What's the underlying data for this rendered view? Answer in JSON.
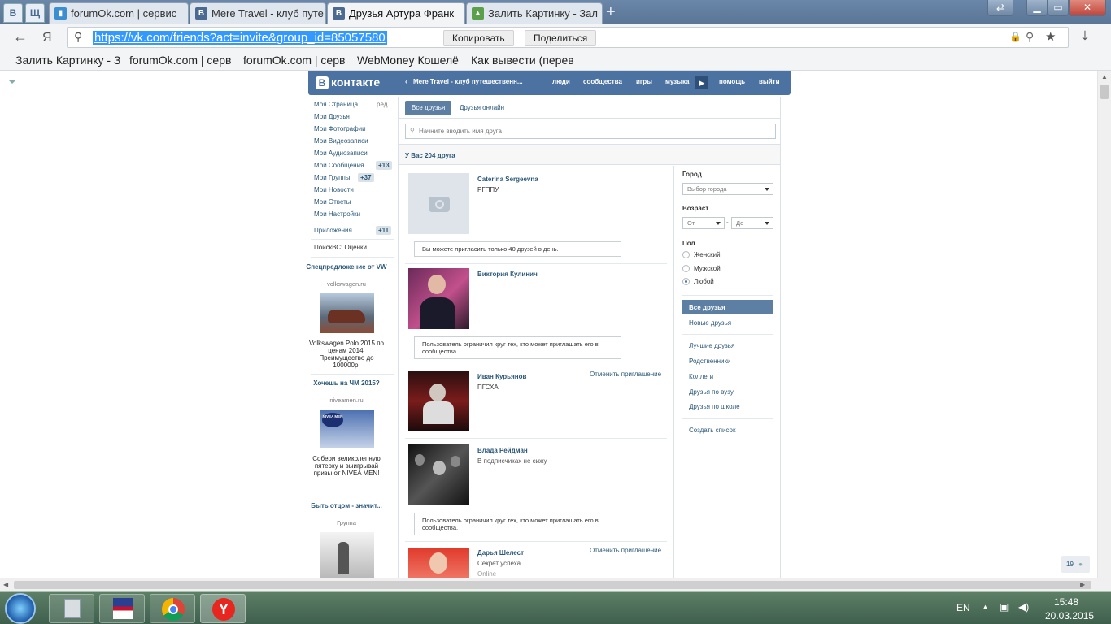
{
  "browser": {
    "pinned_tabs": [
      "В",
      "Щ"
    ],
    "tabs": [
      {
        "title": "forumOk.com | сервис",
        "icon": "chart-icon"
      },
      {
        "title": "Mere Travel - клуб путе",
        "icon": "vk-icon"
      },
      {
        "title": "Друзья Артура Франк",
        "icon": "vk-icon",
        "active": true
      },
      {
        "title": "Залить Картинку - Зал",
        "icon": "image-icon"
      }
    ],
    "new_tab": "+",
    "yandex_letter": "Я",
    "url": "https://vk.com/friends?act=invite&group_id=85057580",
    "copy_label": "Копировать",
    "share_label": "Поделиться",
    "bookmarks": [
      "Залить Картинку - З",
      "forumOk.com | серв",
      "forumOk.com | серв",
      "WebMoney Кошелё",
      "Как вывести (перев"
    ]
  },
  "vk": {
    "logo_b": "В",
    "logo_text": "контакте",
    "nav": {
      "group": "Mere Travel - клуб путешественн...",
      "people": "люди",
      "communities": "сообщества",
      "games": "игры",
      "music": "музыка",
      "help": "помощь",
      "logout": "выйти"
    },
    "left_menu": [
      {
        "label": "Моя Страница",
        "extra": "ред."
      },
      {
        "label": "Мои Друзья"
      },
      {
        "label": "Мои Фотографии"
      },
      {
        "label": "Мои Видеозаписи"
      },
      {
        "label": "Мои Аудиозаписи"
      },
      {
        "label": "Мои Сообщения",
        "count": "+13"
      },
      {
        "label": "Мои Группы",
        "count": "+37"
      },
      {
        "label": "Мои Новости"
      },
      {
        "label": "Мои Ответы"
      },
      {
        "label": "Мои Настройки"
      }
    ],
    "apps": {
      "label": "Приложения",
      "count": "+11"
    },
    "search_app": "ПоискВС: Оценки...",
    "ads": [
      {
        "title": "Спецпредложение от VW",
        "site": "volkswagen.ru",
        "text": "Volkswagen Polo 2015 по ценам 2014. Преимущество до 100000р."
      },
      {
        "title": "Хочешь на ЧМ 2015?",
        "site": "niveamen.ru",
        "text": "Собери великолепную пятерку и выигрывай призы от NIVEA MEN!"
      },
      {
        "title": "Быть отцом - значит...",
        "site": "Группа"
      }
    ],
    "nivea_logo": "NIVEA MEN",
    "tabs": {
      "all": "Все друзья",
      "online": "Друзья онлайн"
    },
    "search_placeholder": "Начните вводить имя друга",
    "count_text": "У Вас 204 друга",
    "friends": [
      {
        "name": "Caterina Sergeevna",
        "sub": "РГППУ",
        "notice": "Вы можете пригласить только 40 друзей в день."
      },
      {
        "name": "Виктория Кулинич",
        "notice": "Пользователь ограничил круг тех, кто может приглашать его в сообщества."
      },
      {
        "name": "Иван Курьянов",
        "sub": "ПГСХА",
        "cancel": "Отменить приглашение"
      },
      {
        "name": "Влада Рейдман",
        "sub": "В подписчиках не сижу",
        "notice": "Пользователь ограничил круг тех, кто может приглашать его в сообщества."
      },
      {
        "name": "Дарья Шелест",
        "sub": "Секрет успеха",
        "status": "Online",
        "cancel": "Отменить приглашение"
      }
    ],
    "filters": {
      "city_label": "Город",
      "city_value": "Выбор города",
      "age_label": "Возраст",
      "age_from": "От",
      "age_dash": "-",
      "age_to": "До",
      "sex_label": "Пол",
      "sex_options": [
        "Женский",
        "Мужской",
        "Любой"
      ],
      "sex_selected": "Любой"
    },
    "right_menu": [
      "Все друзья",
      "Новые друзья",
      "Лучшие друзья",
      "Родственники",
      "Коллеги",
      "Друзья по вузу",
      "Друзья по школе",
      "Создать список"
    ],
    "online_counter": "19"
  },
  "taskbar": {
    "lang": "EN",
    "time": "15:48",
    "date": "20.03.2015"
  }
}
